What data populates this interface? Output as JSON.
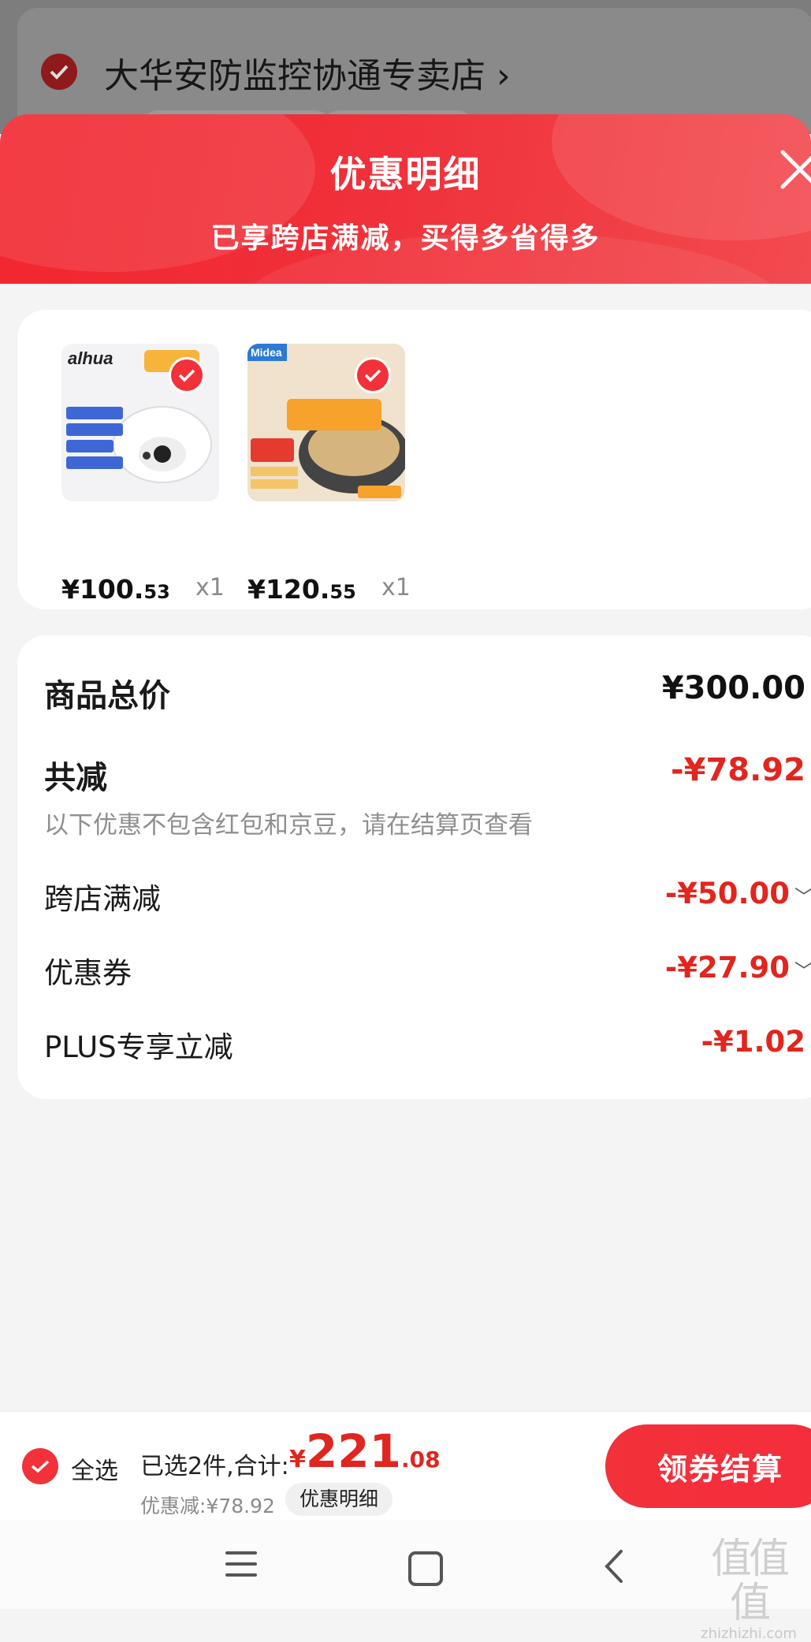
{
  "store": {
    "name": "大华安防监控协通专卖店",
    "arrow": "›"
  },
  "sheet": {
    "title": "优惠明细",
    "subtitle": "已享跨店满减，买得多省得多",
    "close_icon": "close-icon"
  },
  "products": [
    {
      "name": "大华监控摄像头",
      "brand": "alhua",
      "price_int": "¥100.",
      "price_dec": "53",
      "qty": "x1",
      "selected": true
    },
    {
      "name": "美的电饼铛",
      "brand": "Midea",
      "price_int": "¥120.",
      "price_dec": "55",
      "qty": "x1",
      "selected": true
    }
  ],
  "summary": {
    "total_label": "商品总价",
    "total_value": "¥300.00",
    "reduce_label": "共减",
    "reduce_value": "-¥78.92",
    "note": "以下优惠不包含红包和京豆，请在结算页查看",
    "items": [
      {
        "label": "跨店满减",
        "value": "-¥50.00",
        "expandable": true
      },
      {
        "label": "优惠券",
        "value": "-¥27.90",
        "expandable": true
      },
      {
        "label": "PLUS专享立减",
        "value": "-¥1.02",
        "expandable": false
      }
    ]
  },
  "bottom_bar": {
    "select_all": "全选",
    "selected_text": "已选2件,合计:",
    "total_symbol": "¥",
    "total_int": "221",
    "total_dec": ".08",
    "discount_text": "优惠减:¥78.92",
    "detail_chip": "优惠明细",
    "checkout": "领券结算"
  },
  "watermark": {
    "logo": "值值值",
    "url": "zhizhizhi.com"
  },
  "colors": {
    "accent": "#f2313a",
    "price_red": "#e0261f",
    "background": "#f4f4f4"
  }
}
